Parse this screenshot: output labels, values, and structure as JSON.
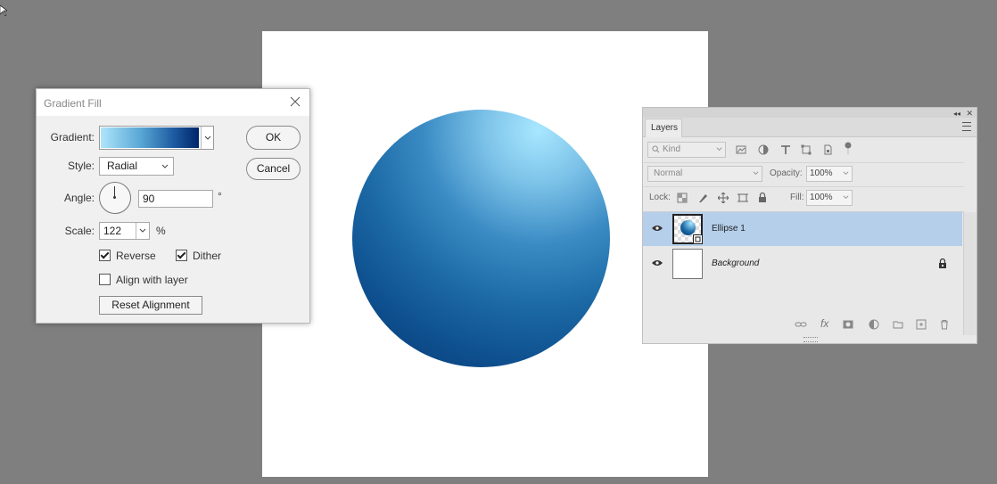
{
  "colors": {
    "workspace": "#7f7f7f",
    "canvas": "#ffffff",
    "gradient_start": "#aee5fb",
    "gradient_end": "#002468",
    "selected_layer": "#b5cfeb"
  },
  "dialog": {
    "title": "Gradient Fill",
    "gradient_label": "Gradient:",
    "style_label": "Style:",
    "style_value": "Radial",
    "angle_label": "Angle:",
    "angle_value": "90",
    "angle_unit": "°",
    "scale_label": "Scale:",
    "scale_value": "122",
    "scale_unit": "%",
    "reverse_label": "Reverse",
    "reverse_checked": true,
    "dither_label": "Dither",
    "dither_checked": true,
    "align_label": "Align with layer",
    "align_checked": false,
    "reset_label": "Reset Alignment",
    "ok_label": "OK",
    "cancel_label": "Cancel"
  },
  "layers_panel": {
    "tab_label": "Layers",
    "kind_filter": "Kind",
    "blend_mode": "Normal",
    "opacity_label": "Opacity:",
    "opacity_value": "100%",
    "lock_label": "Lock:",
    "fill_label": "Fill:",
    "fill_value": "100%",
    "layers": [
      {
        "name": "Ellipse 1",
        "visible": true,
        "selected": true
      },
      {
        "name": "Background",
        "visible": true,
        "selected": false,
        "locked": true
      }
    ],
    "bottom_icons": [
      "link-icon",
      "fx-icon",
      "mask-icon",
      "adjustment-icon",
      "folder-icon",
      "new-layer-icon",
      "trash-icon"
    ],
    "fx_label": "fx"
  }
}
